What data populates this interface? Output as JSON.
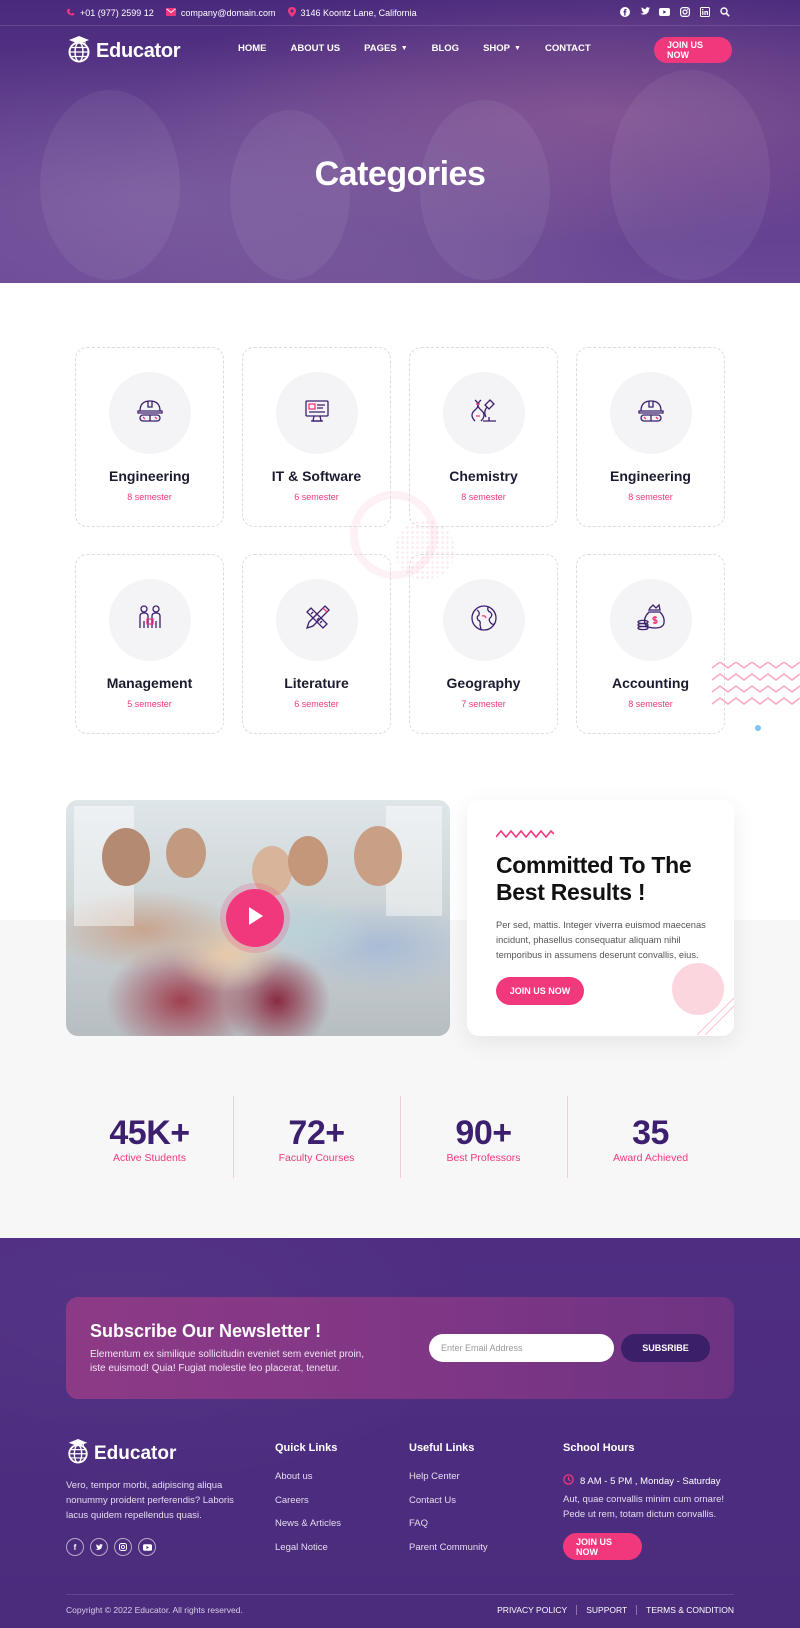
{
  "colors": {
    "brand_purple": "#4a2a7d",
    "accent_pink": "#f2387d",
    "stat_number": "#3c1f6e",
    "footer_bg": "#4f2e82"
  },
  "topbar": {
    "phone": "+01 (977) 2599 12",
    "email": "company@domain.com",
    "address": "3146 Koontz Lane, California",
    "social_icons": [
      "facebook-icon",
      "twitter-icon",
      "youtube-icon",
      "instagram-icon",
      "linkedin-icon",
      "search-icon"
    ]
  },
  "header": {
    "logo_text": "Educator",
    "nav": [
      {
        "label": "HOME"
      },
      {
        "label": "ABOUT US"
      },
      {
        "label": "PAGES"
      },
      {
        "label": "BLOG"
      },
      {
        "label": "SHOP"
      },
      {
        "label": "CONTACT"
      }
    ],
    "cta_label": "JOIN US NOW"
  },
  "hero": {
    "title": "Categories"
  },
  "categories": [
    {
      "name": "Engineering",
      "semester": "8 semester",
      "icon": "engineering-helmet-icon"
    },
    {
      "name": "IT & Software",
      "semester": "6 semester",
      "icon": "computer-screen-icon"
    },
    {
      "name": "Chemistry",
      "semester": "8 semester",
      "icon": "microscope-dna-icon"
    },
    {
      "name": "Engineering",
      "semester": "8 semester",
      "icon": "engineering-helmet-icon"
    },
    {
      "name": "Management",
      "semester": "5 semester",
      "icon": "team-people-icon"
    },
    {
      "name": "Literature",
      "semester": "6 semester",
      "icon": "pencil-ruler-icon"
    },
    {
      "name": "Geography",
      "semester": "7 semester",
      "icon": "globe-icon"
    },
    {
      "name": "Accounting",
      "semester": "8 semester",
      "icon": "money-bag-icon"
    }
  ],
  "committed": {
    "title": "Committed To The Best Results !",
    "description": "Per sed, mattis. Integer viverra euismod maecenas incidunt, phasellus consequatur aliquam nihil temporibus in assumens deserunt convallis, eius.",
    "button_label": "JOIN US NOW"
  },
  "stats": [
    {
      "number": "45K+",
      "label": "Active Students"
    },
    {
      "number": "72+",
      "label": "Faculty Courses"
    },
    {
      "number": "90+",
      "label": "Best Professors"
    },
    {
      "number": "35",
      "label": "Award Achieved"
    }
  ],
  "newsletter": {
    "title": "Subscribe Our Newsletter !",
    "description": "Elementum ex similique sollicitudin eveniet sem eveniet proin, iste euismod! Quia! Fugiat molestie leo placerat, tenetur.",
    "email_placeholder": "Enter Email Address",
    "button_label": "SUBSRIBE"
  },
  "footer": {
    "logo_text": "Educator",
    "about": "Vero, tempor morbi, adipiscing aliqua nonummy proident perferendis? Laboris lacus quidem repellendus quasi.",
    "social_icons": [
      "facebook-icon",
      "twitter-icon",
      "instagram-icon",
      "youtube-icon"
    ],
    "quick_links": {
      "heading": "Quick Links",
      "items": [
        "About us",
        "Careers",
        "News & Articles",
        "Legal Notice"
      ]
    },
    "useful_links": {
      "heading": "Useful Links",
      "items": [
        "Help Center",
        "Contact Us",
        "FAQ",
        "Parent Community"
      ]
    },
    "school_hours": {
      "heading": "School Hours",
      "time": "8 AM - 5 PM , Monday - Saturday",
      "description": "Aut, quae convallis minim cum ornare! Pede ut rem, totam dictum convallis.",
      "button_label": "JOIN US NOW"
    },
    "copyright": "Copyright © 2022 Educator. All rights reserved.",
    "bottom_links": [
      "PRIVACY POLICY",
      "SUPPORT",
      "TERMS & CONDITION"
    ]
  }
}
